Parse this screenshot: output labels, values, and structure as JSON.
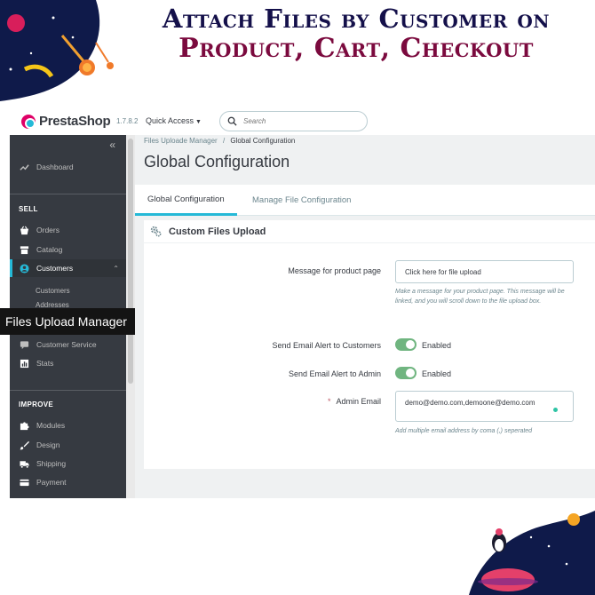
{
  "banner": {
    "line1": "Attach Files by Customer on",
    "line2": "Product, Cart, Checkout"
  },
  "header": {
    "logo_text": "PrestaShop",
    "version": "1.7.8.2",
    "quick_access_label": "Quick Access",
    "search_placeholder": "Search"
  },
  "sidebar": {
    "dashboard": "Dashboard",
    "sell_label": "SELL",
    "orders": "Orders",
    "catalog": "Catalog",
    "customers": "Customers",
    "sub_customers": "Customers",
    "sub_addresses": "Addresses",
    "customer_service": "Customer Service",
    "stats": "Stats",
    "improve_label": "IMPROVE",
    "modules": "Modules",
    "design": "Design",
    "shipping": "Shipping",
    "payment": "Payment",
    "tooltip": "Files Upload Manager"
  },
  "breadcrumb": {
    "parent": "Files Uploade Manager",
    "separator": "/",
    "current": "Global Configuration"
  },
  "page_title": "Global Configuration",
  "tabs": [
    "Global Configuration",
    "Manage File Configuration"
  ],
  "panel": {
    "title": "Custom Files Upload",
    "message_label": "Message for product page",
    "message_value": "Click here for file upload",
    "message_help": "Make a message for your product page. This message will be linked, and you will scroll down to the file upload box.",
    "alert_customers_label": "Send Email Alert to Customers",
    "alert_customers_state": "Enabled",
    "alert_admin_label": "Send Email Alert to Admin",
    "alert_admin_state": "Enabled",
    "admin_email_required": "*",
    "admin_email_label": "Admin Email",
    "admin_email_value": "demo@demo.com,demoone@demo.com",
    "admin_email_help": "Add multiple email address by coma (,) seperated"
  },
  "colors": {
    "accent": "#25b9d7",
    "sidebar_bg": "#363a41",
    "toggle_on": "#70b580",
    "banner_line1": "#14104a",
    "banner_line2": "#7b0a3e"
  },
  "icons": {
    "dashboard": "trend-icon",
    "orders": "basket-icon",
    "catalog": "store-icon",
    "customers": "user-circle-icon",
    "customer_service": "chat-icon",
    "stats": "bar-chart-icon",
    "modules": "puzzle-icon",
    "design": "brush-icon",
    "shipping": "truck-icon",
    "payment": "card-icon",
    "panel": "gears-icon"
  }
}
